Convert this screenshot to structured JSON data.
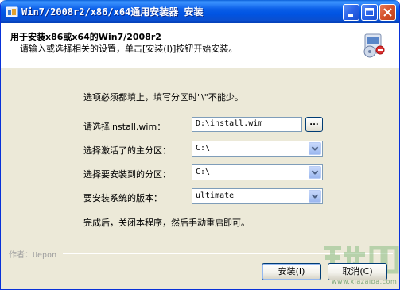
{
  "window": {
    "title": "Win7/2008r2/x86/x64通用安装器 安装"
  },
  "header": {
    "title": "用于安装x86或x64的Win7/2008r2",
    "subtitle": "请输入或选择相关的设置，单击[安装(I)]按钮开始安装。"
  },
  "main": {
    "instruction": "选项必须都填上，填写分区时\"\\\"不能少。",
    "fields": {
      "wim_label": "请选择install.wim：",
      "wim_value": "D:\\install.wim",
      "browse_label": "...",
      "active_label": "选择激活了的主分区：",
      "active_value": "C:\\",
      "target_label": "选择要安装到的分区：",
      "target_value": "C:\\",
      "edition_label": "要安装系统的版本：",
      "edition_value": "ultimate"
    },
    "completion": "完成后，关闭本程序，然后手动重启即可。"
  },
  "footer": {
    "author": "作者：Uepon",
    "install_label": "安装(I)",
    "cancel_label": "取消(C)"
  },
  "watermark": {
    "url": "www.xiazaiba.com"
  },
  "colors": {
    "titlebar": "#0054e3",
    "dialog_bg": "#ece9d8",
    "header_bg": "#ffffff",
    "input_border": "#7f9db9",
    "button_border": "#003c74"
  },
  "icons": {
    "app": "installer-icon",
    "header": "setup-disk-icon",
    "minimize": "minimize-icon",
    "maximize": "maximize-icon",
    "close": "close-icon",
    "dropdown": "chevron-down-icon"
  }
}
